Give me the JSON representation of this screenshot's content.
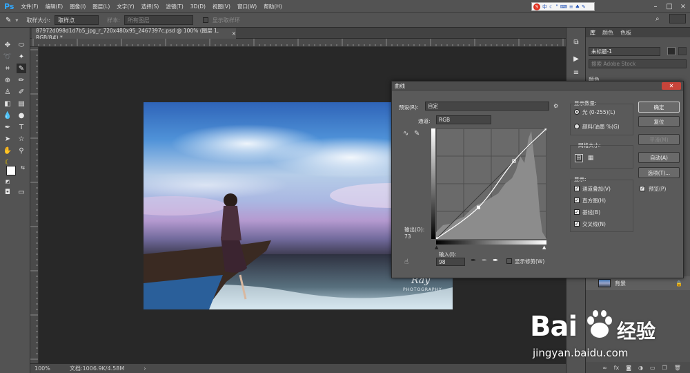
{
  "app": {
    "logo": "Ps"
  },
  "menu": [
    "文件(F)",
    "编辑(E)",
    "图像(I)",
    "图层(L)",
    "文字(Y)",
    "选择(S)",
    "滤镜(T)",
    "3D(D)",
    "视图(V)",
    "窗口(W)",
    "帮助(H)"
  ],
  "ime": {
    "items": [
      "S",
      "中",
      "☾",
      "°",
      "⌨",
      "≡",
      "♣",
      "✎"
    ]
  },
  "options": {
    "sample_size_label": "取样大小:",
    "sample_size_value": "取样点",
    "sample_label": "样本:",
    "sample_value": "所有图层",
    "show_ring_label": "显示取样环"
  },
  "document": {
    "tab_title": "87972d098d1d7b5_jpg_r_720x480x95_2467397c.psd @ 100% (图层 1, RGB/8#) *",
    "close": "×"
  },
  "status": {
    "zoom": "100%",
    "doc_size": "文档:1006.9K/4.58M"
  },
  "photo": {
    "signature": "Ray",
    "signature_sub": "PHOTOGRAPHY"
  },
  "right_panel": {
    "tabs": [
      "库",
      "颜色",
      "色板"
    ],
    "library_select": "未标题-1",
    "search_placeholder": "搜索 Adobe Stock",
    "layer_name": "背景",
    "layer_header": "颜色"
  },
  "curves": {
    "title": "曲线",
    "close": "✕",
    "preset_label": "预设(R):",
    "preset_value": "自定",
    "channel_label": "通道:",
    "channel_value": "RGB",
    "output_label": "输出(O):",
    "output_value": "73",
    "input_label": "输入(I):",
    "input_value": "98",
    "show_clipping": "显示修剪(W)",
    "display_amount_title": "显示数量:",
    "light_option": "光 (0-255)(L)",
    "pigment_option": "颜料/油墨 %(G)",
    "grid_size_title": "网格大小:",
    "show_title": "显示:",
    "show_options": [
      "通道叠加(V)",
      "直方图(H)",
      "基线(B)",
      "交叉线(N)"
    ],
    "buttons": {
      "ok": "确定",
      "reset": "复位",
      "smooth": "平滑(M)",
      "auto": "自动(A)",
      "options": "选项(T)...",
      "preview": "预览(P)"
    },
    "curve_points": [
      [
        0,
        0
      ],
      [
        98,
        73
      ],
      [
        180,
        180
      ],
      [
        255,
        255
      ]
    ]
  },
  "watermark": {
    "brand": "Bai",
    "brand_cn": "经验",
    "url": "jingyan.baidu.com"
  },
  "colors": {
    "accent": "#31a8ff",
    "panel": "#535353",
    "dialog": "#5a5a5a",
    "close": "#c8443a",
    "baidu_red": "#de2910",
    "baidu_blue": "#2f5fd2"
  }
}
